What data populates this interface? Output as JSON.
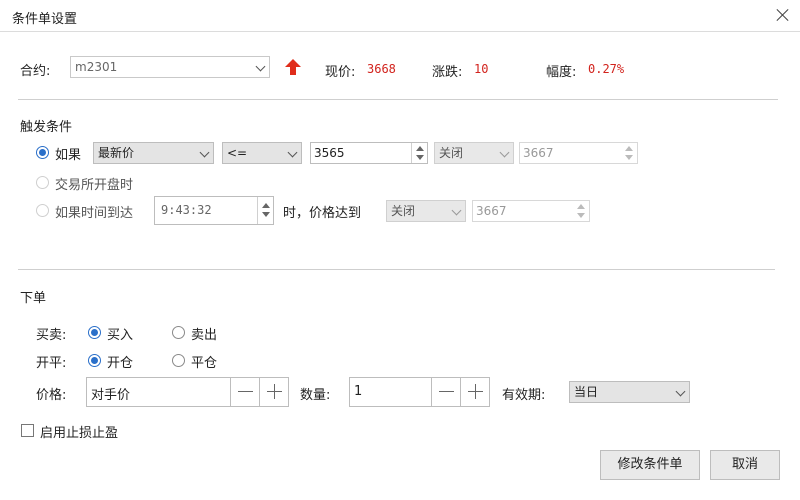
{
  "window": {
    "title": "条件单设置"
  },
  "contract": {
    "label": "合约:",
    "value": "m2301",
    "current_price_label": "现价:",
    "current_price": "3668",
    "change_label": "涨跌:",
    "change": "10",
    "amplitude_label": "幅度:",
    "amplitude": "0.27%"
  },
  "trigger": {
    "section_title": "触发条件",
    "option_if": "如果",
    "price_type": "最新价",
    "operator": "<=",
    "price_value": "3565",
    "switch1": "关闭",
    "value1": "3667",
    "option_open": "交易所开盘时",
    "option_time": "如果时间到达",
    "time_value": "9:43:32",
    "time_suffix": "时，价格达到",
    "switch2": "关闭",
    "value2": "3667"
  },
  "order": {
    "section_title": "下单",
    "buy_sell_label": "买卖:",
    "buy": "买入",
    "sell": "卖出",
    "open_close_label": "开平:",
    "open": "开仓",
    "close": "平仓",
    "price_label": "价格:",
    "price_value": "对手价",
    "qty_label": "数量:",
    "qty_value": "1",
    "validity_label": "有效期:",
    "validity_value": "当日",
    "stop_loss_label": "启用止损止盈"
  },
  "buttons": {
    "modify": "修改条件单",
    "cancel": "取消"
  },
  "colors": {
    "up": "#d2231d",
    "accent": "#2a6fc9"
  },
  "icons": {
    "trend": "arrow-up-icon",
    "close": "close-icon"
  }
}
